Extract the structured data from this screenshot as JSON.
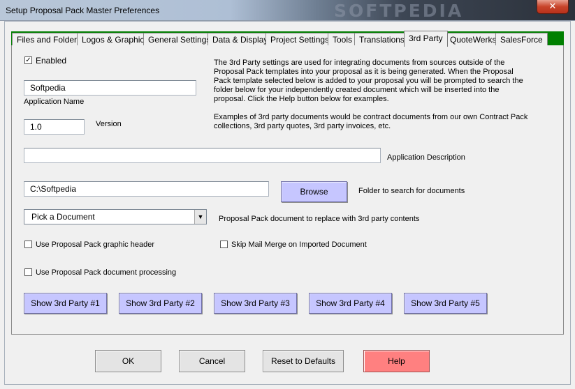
{
  "window": {
    "title": "Setup Proposal Pack Master Preferences",
    "watermark": "SOFTPEDIA",
    "close_label": "✕"
  },
  "tabs": [
    {
      "label": "Files and Folders"
    },
    {
      "label": "Logos & Graphics"
    },
    {
      "label": "General Settings"
    },
    {
      "label": "Data & Display"
    },
    {
      "label": "Project Settings"
    },
    {
      "label": "Tools"
    },
    {
      "label": "Translations"
    },
    {
      "label": "3rd Party"
    },
    {
      "label": "QuoteWerks"
    },
    {
      "label": "SalesForce"
    }
  ],
  "active_tab": "3rd Party",
  "enabled": {
    "label": "Enabled",
    "checked": true,
    "check_glyph": "✓"
  },
  "app_name": {
    "value": "Softpedia",
    "label": "Application Name"
  },
  "version": {
    "value": "1.0",
    "label": "Version"
  },
  "description": {
    "paragraph1": "The 3rd Party settings are used for integrating documents from sources outside of the Proposal Pack templates into your proposal as it is being generated. When the Proposal Pack template selected below is added to your proposal you will be prompted to search the folder below for your independently created document which will be inserted into the proposal. Click the Help button below for examples.",
    "paragraph2": "Examples of 3rd party documents would be contract documents from our own Contract Pack collections, 3rd party quotes, 3rd party invoices, etc."
  },
  "app_description": {
    "value": "",
    "label": "Application Description"
  },
  "folder": {
    "value": "C:\\Softpedia",
    "browse_label": "Browse",
    "label": "Folder to search for documents"
  },
  "document": {
    "selected": "Pick a Document",
    "label": "Proposal Pack document to replace with 3rd party contents"
  },
  "options": {
    "graphic_header": {
      "label": "Use Proposal Pack graphic header",
      "checked": false
    },
    "skip_mail_merge": {
      "label": "Skip Mail Merge on Imported Document",
      "checked": false
    },
    "doc_processing": {
      "label": "Use Proposal Pack document processing",
      "checked": false
    }
  },
  "show_buttons": [
    {
      "label": "Show 3rd Party #1"
    },
    {
      "label": "Show 3rd Party #2"
    },
    {
      "label": "Show 3rd Party #3"
    },
    {
      "label": "Show 3rd Party #4"
    },
    {
      "label": "Show 3rd Party #5"
    }
  ],
  "footer": {
    "ok_label": "OK",
    "cancel_label": "Cancel",
    "reset_label": "Reset to Defaults",
    "help_label": "Help"
  },
  "colors": {
    "tabstrip": "#008000",
    "show_button": "#c6c6ff",
    "help_button": "#ff8080"
  }
}
